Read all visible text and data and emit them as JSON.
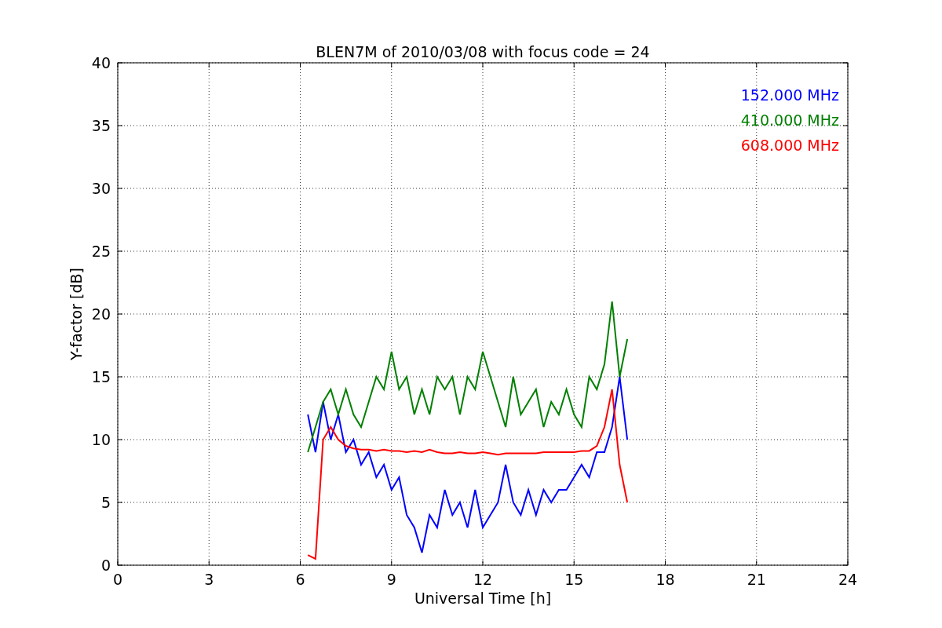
{
  "chart_data": {
    "type": "line",
    "title": "BLEN7M of 2010/03/08 with focus code = 24",
    "xlabel": "Universal Time [h]",
    "ylabel": "Y-factor [dB]",
    "x": [
      6.25,
      6.5,
      6.75,
      7.0,
      7.25,
      7.5,
      7.75,
      8.0,
      8.25,
      8.5,
      8.75,
      9.0,
      9.25,
      9.5,
      9.75,
      10.0,
      10.25,
      10.5,
      10.75,
      11.0,
      11.25,
      11.5,
      11.75,
      12.0,
      12.25,
      12.5,
      12.75,
      13.0,
      13.25,
      13.5,
      13.75,
      14.0,
      14.25,
      14.5,
      14.75,
      15.0,
      15.25,
      15.5,
      15.75,
      16.0,
      16.25,
      16.5,
      16.75
    ],
    "series": [
      {
        "name": "152.000 MHz",
        "color": "#0000ff",
        "values": [
          12,
          9,
          13,
          10,
          12,
          9,
          10,
          8,
          9,
          7,
          8,
          6,
          7,
          4,
          3,
          1,
          4,
          3,
          6,
          4,
          5,
          3,
          6,
          3,
          4,
          5,
          8,
          5,
          4,
          6,
          4,
          6,
          5,
          6,
          6,
          7,
          8,
          7,
          9,
          9,
          11,
          15,
          10
        ]
      },
      {
        "name": "410.000 MHz",
        "color": "#008000",
        "values": [
          9,
          11,
          13,
          14,
          12,
          14,
          12,
          11,
          13,
          15,
          14,
          17,
          14,
          15,
          12,
          14,
          12,
          15,
          14,
          15,
          12,
          15,
          14,
          17,
          15,
          13,
          11,
          15,
          12,
          13,
          14,
          11,
          13,
          12,
          14,
          12,
          11,
          15,
          14,
          16,
          21,
          15,
          18
        ]
      },
      {
        "name": "608.000 MHz",
        "color": "#ff0000",
        "values": [
          0.8,
          0.5,
          10,
          11,
          10,
          9.5,
          9.3,
          9.2,
          9.2,
          9.1,
          9.2,
          9.1,
          9.1,
          9.0,
          9.1,
          9.0,
          9.2,
          9.0,
          8.9,
          8.9,
          9.0,
          8.9,
          8.9,
          9.0,
          8.9,
          8.8,
          8.9,
          8.9,
          8.9,
          8.9,
          8.9,
          9.0,
          9.0,
          9.0,
          9.0,
          9.0,
          9.1,
          9.1,
          9.5,
          11,
          14,
          8,
          5
        ]
      }
    ],
    "xlim": [
      0,
      24
    ],
    "ylim": [
      0,
      40
    ],
    "xticks": [
      0,
      3,
      6,
      9,
      12,
      15,
      18,
      21,
      24
    ],
    "yticks": [
      0,
      5,
      10,
      15,
      20,
      25,
      30,
      35,
      40
    ],
    "grid": true
  }
}
